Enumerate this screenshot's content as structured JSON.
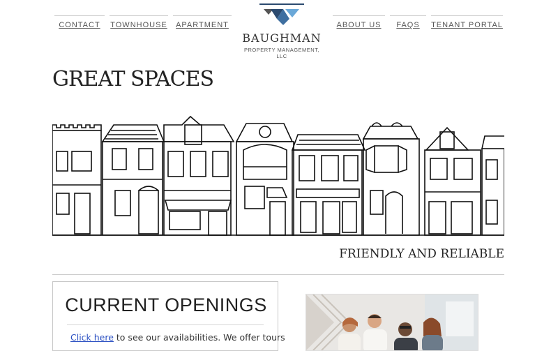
{
  "nav": {
    "left": [
      {
        "label": "CONTACT"
      },
      {
        "label": "TOWNHOUSE"
      },
      {
        "label": "APARTMENT"
      }
    ],
    "right": [
      {
        "label": "ABOUT US"
      },
      {
        "label": "FAQS"
      },
      {
        "label": "TENANT PORTAL"
      }
    ]
  },
  "logo": {
    "name": "BAUGHMAN",
    "subtitle": "PROPERTY MANAGEMENT, LLC",
    "colors": {
      "dark": "#2b4a6f",
      "mid": "#3f6fa0",
      "light": "#6aa8d8",
      "grey": "#555555"
    }
  },
  "hero": {
    "title": "GREAT SPACES",
    "tagline": "FRIENDLY AND RELIABLE"
  },
  "openings": {
    "title": "CURRENT OPENINGS",
    "link_text": "Click here",
    "text_after_link": " to see our availabilities.  We offer tours"
  },
  "theme": {
    "link_color": "#2a4fc2",
    "divider_color": "#cccccc"
  }
}
